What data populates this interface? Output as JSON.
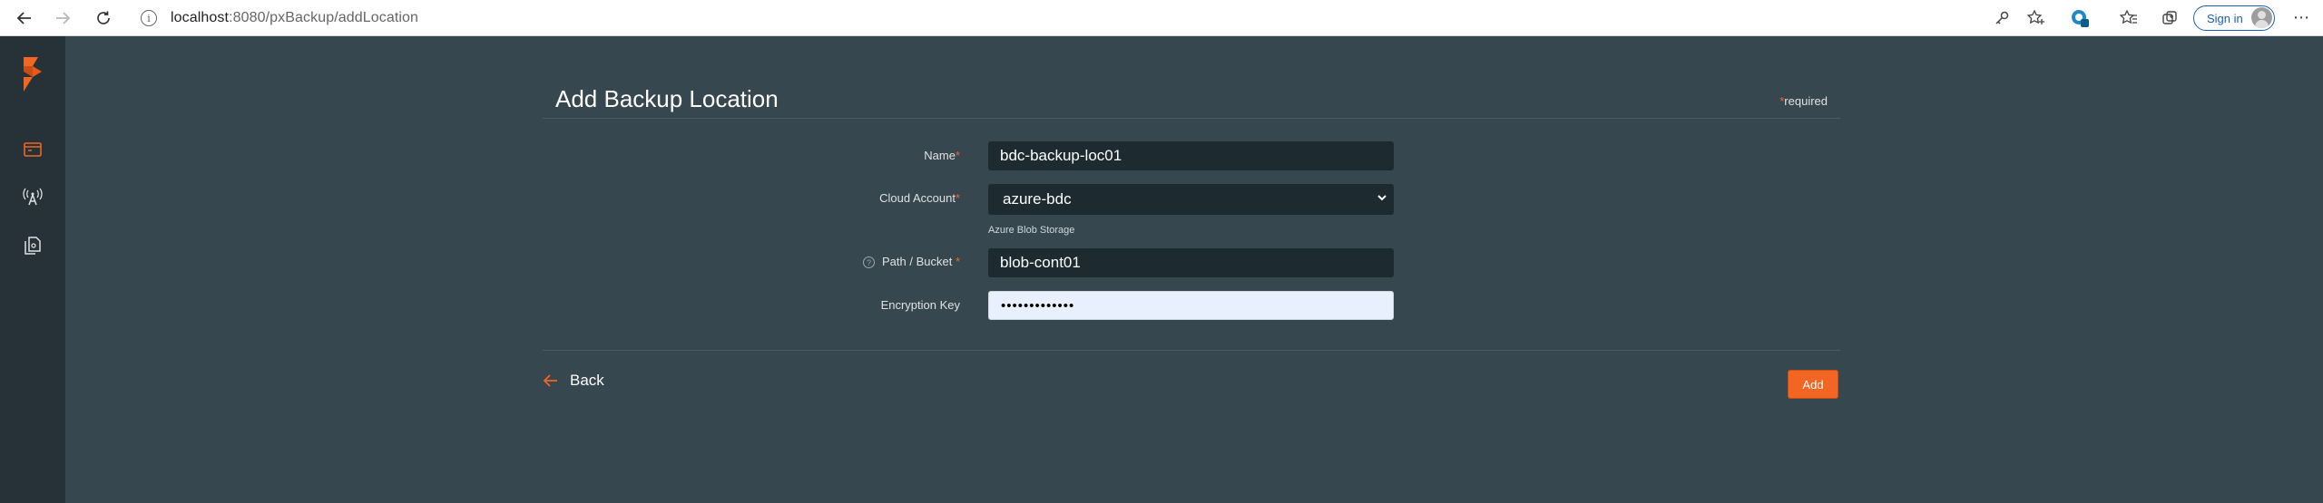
{
  "browser": {
    "url_host": "localhost",
    "url_path": ":8080/pxBackup/addLocation",
    "signin_label": "Sign in"
  },
  "icons": {
    "back": "arrow-left-icon",
    "forward": "arrow-right-icon",
    "refresh": "refresh-icon",
    "info": "info-icon",
    "brand": "portworx-logo",
    "nav_backups": "backups-icon",
    "nav_locations": "antenna-icon",
    "nav_docs": "document-icon"
  },
  "page": {
    "title": "Add Backup Location",
    "required_star": "*",
    "required_label": "required"
  },
  "form": {
    "name_label": "Name",
    "name_value": "bdc-backup-loc01",
    "cloud_account_label": "Cloud Account",
    "cloud_account_value": "azure-bdc",
    "cloud_account_hint": "Azure Blob Storage",
    "path_label": "Path / Bucket ",
    "path_value": "blob-cont01",
    "encryption_label": "Encryption Key",
    "encryption_value": "•••••••••••••",
    "required_star": "*"
  },
  "actions": {
    "back_label": "Back",
    "add_label": "Add"
  },
  "colors": {
    "accent": "#f26522",
    "background": "#37474f",
    "sidebar": "#263238",
    "input_bg": "#1d2b31"
  }
}
